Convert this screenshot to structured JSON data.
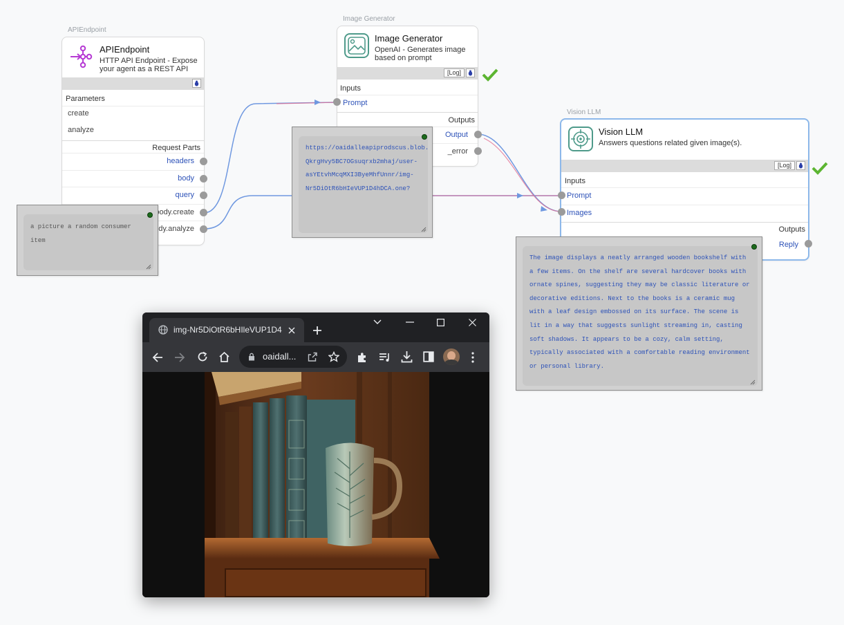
{
  "colors": {
    "wire_blue": "#6f98e0",
    "wire_pink": "#e26f91",
    "port_label": "#2d52b8",
    "check_green": "#5cb531",
    "node_border_selected": "#8db8ea"
  },
  "api_node": {
    "caption": "APIEndpoint",
    "title": "APIEndpoint",
    "description": "HTTP API Endpoint - Expose your agent as a REST API",
    "icon": "api-endpoint-icon",
    "params_label": "Parameters",
    "params": [
      "create",
      "analyze"
    ],
    "request_parts_label": "Request Parts",
    "outputs": [
      "headers",
      "body",
      "query",
      "body.create",
      "body.analyze"
    ]
  },
  "image_node": {
    "caption": "Image Generator",
    "title": "Image Generator",
    "description": "OpenAI - Generates image based on prompt",
    "icon": "image-icon",
    "log_label": "[Log]",
    "inputs_label": "Inputs",
    "input_prompt": "Prompt",
    "outputs_label": "Outputs",
    "output_main": "Output",
    "output_error": "_error"
  },
  "vision_node": {
    "caption": "Vision LLM",
    "title": "Vision LLM",
    "description": "Answers questions related given image(s).",
    "icon": "vision-target-icon",
    "log_label": "[Log]",
    "inputs_label": "Inputs",
    "input_prompt": "Prompt",
    "input_images": "Images",
    "outputs_label": "Outputs",
    "output_reply": "Reply"
  },
  "popups": {
    "api_value": "a picture a random consumer item",
    "image_url": "https://oaidalleapiprodscus.blob.core.windows.net/private/org-QkrgHvy5BC7OGsuqrxb2mhaj/user-asYEtvhMcqMXI3ByeMhfUnnr/img-Nr5DiOtR6bHIeVUP1D4hDCA.one?",
    "vision_reply": "The image displays a neatly arranged wooden bookshelf with a few items. On the shelf are several hardcover books with ornate spines, suggesting they may be classic literature or decorative editions. Next to the books is a ceramic mug with a leaf design embossed on its surface. The scene is lit in a way that suggests sunlight streaming in, casting soft shadows. It appears to be a cozy, calm setting, typically associated with a comfortable reading environment or personal library."
  },
  "browser": {
    "tab_title": "img-Nr5DiOtR6bHIleVUP1D4",
    "address": "oaidall...",
    "image_alt": "bookshelf-image"
  }
}
